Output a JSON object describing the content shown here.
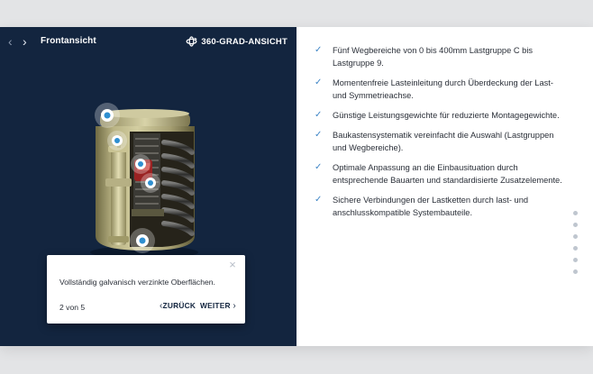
{
  "header": {
    "view_title": "Frontansicht",
    "view360_label": "360-GRAD-ANSICHT",
    "prev_icon": "chevron-left-icon",
    "next_icon": "chevron-right-icon",
    "rotate_icon": "rotate-360-icon"
  },
  "popup": {
    "text": "Vollständig galvanisch verzinkte Oberflächen.",
    "counter": "2 von 5",
    "back_label": "ZURÜCK",
    "next_label": "WEITER",
    "close_icon": "close-icon"
  },
  "features": [
    "Fünf Wegbereiche von 0 bis 400mm Lastgruppe C bis Lastgruppe 9.",
    "Momentenfreie Lasteinleitung durch Überdeckung der Last- und Symmetrieachse.",
    "Günstige Leistungsgewichte für reduzierte Montagegewichte.",
    "Baukastensystematik vereinfacht die Auswahl (Lastgruppen und Wegbereiche).",
    "Optimale Anpassung an die Einbausituation durch entsprechende Bauarten und standardisierte Zusatzelemente.",
    "Sichere Verbindungen der Lastketten durch last- und anschlusskompatible Systembauteile."
  ],
  "colors": {
    "panel_bg": "#13253f",
    "accent": "#3f86c6",
    "hotspot": "#2f8fd0"
  }
}
